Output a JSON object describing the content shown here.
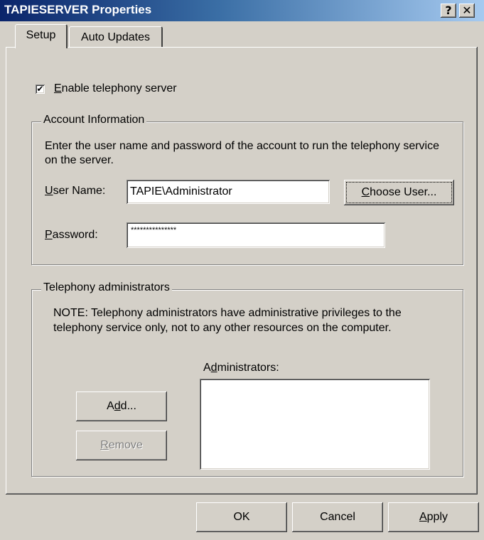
{
  "window": {
    "title": "TAPIESERVER Properties",
    "help_glyph": "?",
    "close_glyph": "✕"
  },
  "tabs": [
    {
      "label": "Setup",
      "active": true
    },
    {
      "label": "Auto Updates",
      "active": false
    }
  ],
  "enable_server": {
    "label_u": "E",
    "label_rest": "nable telephony server",
    "checked": true,
    "check_glyph": "✔"
  },
  "account": {
    "title": "Account Information",
    "description": "Enter the user name and password of the account to run the telephony service on the server.",
    "user_label_u": "U",
    "user_label_rest": "ser Name:",
    "user_value": "TAPIE\\Administrator",
    "password_label_u": "P",
    "password_label_rest": "assword:",
    "password_value": "***************",
    "choose_user_u": "C",
    "choose_user_rest": "hoose User..."
  },
  "admins": {
    "title": "Telephony administrators",
    "note": "NOTE: Telephony administrators have administrative privileges to the telephony service only, not to any other resources on the computer.",
    "list_label_a": "A",
    "list_label_u": "d",
    "list_label_b": "ministrators:",
    "add_a": "A",
    "add_u": "d",
    "add_b": "d...",
    "remove_u": "R",
    "remove_rest": "emove",
    "remove_enabled": false,
    "items": []
  },
  "footer": {
    "ok": "OK",
    "cancel": "Cancel",
    "apply_u": "A",
    "apply_rest": "pply"
  },
  "colors": {
    "dialog_bg": "#d4d0c8",
    "title_start": "#0a246a",
    "title_end": "#a6caf0",
    "disabled_text": "#808080"
  }
}
